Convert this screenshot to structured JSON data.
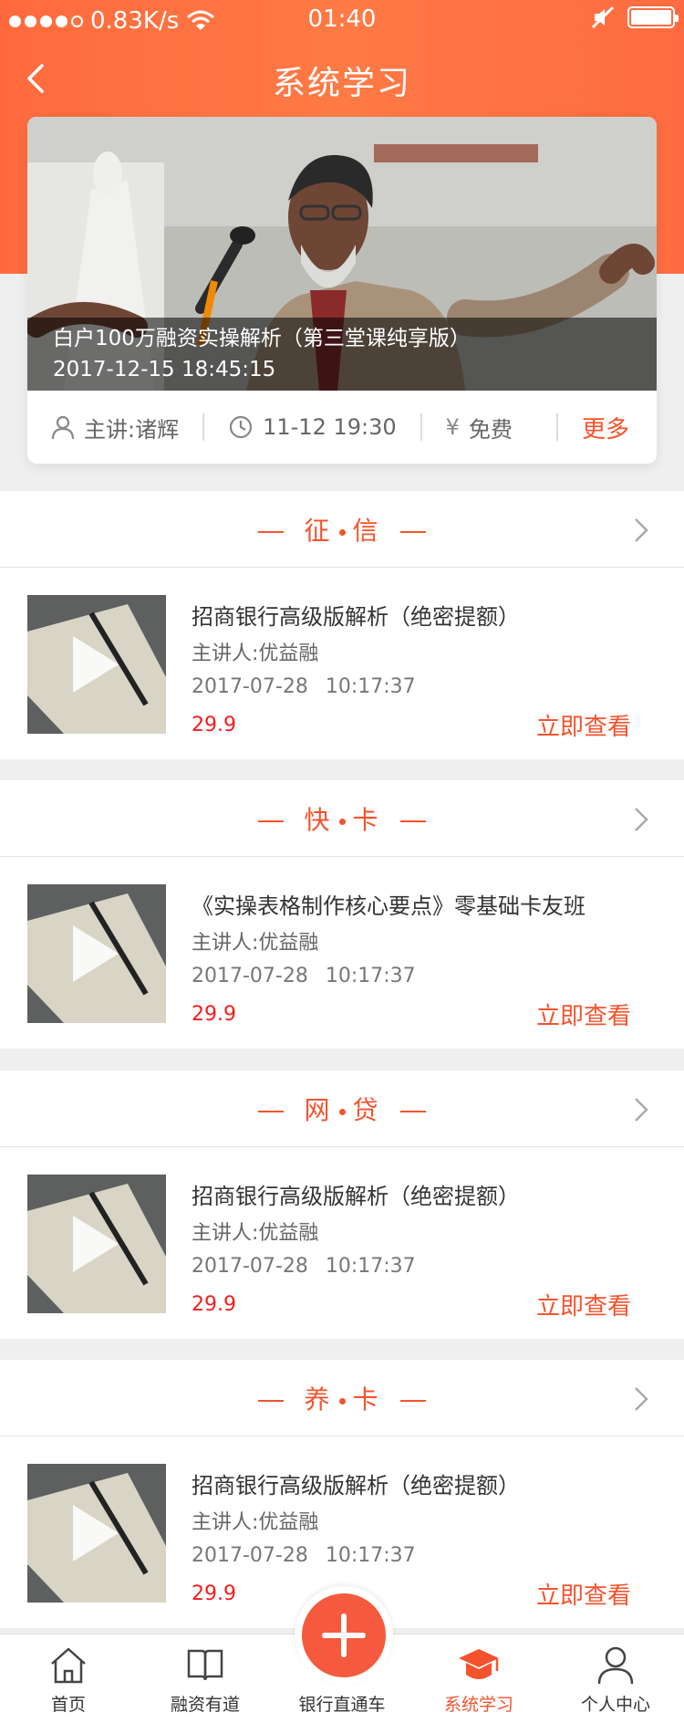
{
  "status_bar": {
    "network": "0.83K/s",
    "time": "01:40"
  },
  "header": {
    "title": "系统学习"
  },
  "featured": {
    "title": "白户100万融资实操解析（第三堂课纯享版）",
    "datetime": "2017-12-15 18:45:15",
    "speaker": "主讲:诸辉",
    "time": "11-12 19:30",
    "currency_symbol": "¥",
    "price": "免费",
    "more": "更多"
  },
  "sections": [
    {
      "title_left": "征",
      "title_right": "信",
      "item": {
        "title": "招商银行高级版解析（绝密提额）",
        "speaker": "主讲人:优益融",
        "datetime": "2017-07-28 10:17:37",
        "price": "29.9",
        "action": "立即查看"
      }
    },
    {
      "title_left": "快",
      "title_right": "卡",
      "item": {
        "title": "《实操表格制作核心要点》零基础卡友班",
        "speaker": "主讲人:优益融",
        "datetime": "2017-07-28 10:17:37",
        "price": "29.9",
        "action": "立即查看"
      }
    },
    {
      "title_left": "网",
      "title_right": "贷",
      "item": {
        "title": "招商银行高级版解析（绝密提额）",
        "speaker": "主讲人:优益融",
        "datetime": "2017-07-28 10:17:37",
        "price": "29.9",
        "action": "立即查看"
      }
    },
    {
      "title_left": "养",
      "title_right": "卡",
      "item": {
        "title": "招商银行高级版解析（绝密提额）",
        "speaker": "主讲人:优益融",
        "datetime": "2017-07-28 10:17:37",
        "price": "29.9",
        "action": "立即查看"
      }
    }
  ],
  "tabbar": {
    "items": [
      {
        "label": "首页",
        "icon": "home-icon"
      },
      {
        "label": "融资有道",
        "icon": "book-icon"
      },
      {
        "label": "银行直通车",
        "icon": "plus-icon"
      },
      {
        "label": "系统学习",
        "icon": "graduation-cap-icon",
        "active": true
      },
      {
        "label": "个人中心",
        "icon": "user-icon"
      }
    ]
  },
  "colors": {
    "accent": "#f5532d",
    "price": "#f51c1c",
    "header_gradient": "#ff6a3d"
  }
}
